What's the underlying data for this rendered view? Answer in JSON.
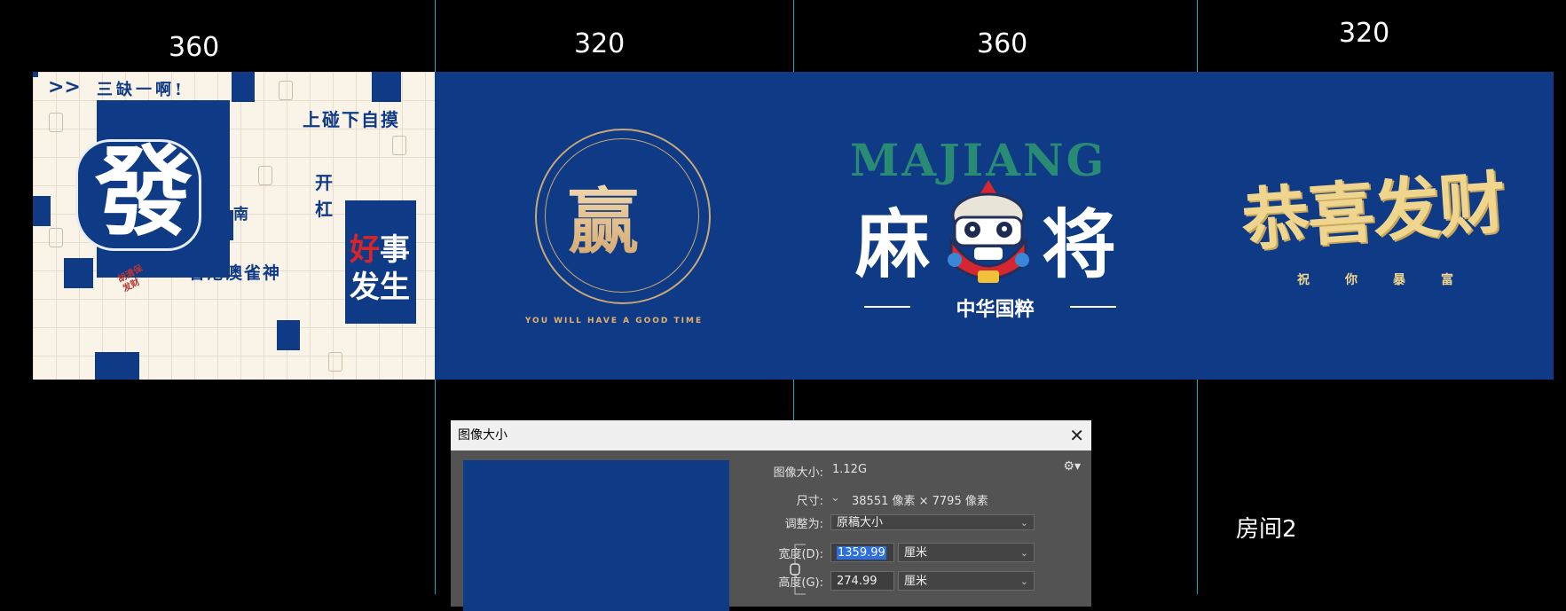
{
  "guides": [
    490,
    894,
    1349
  ],
  "widths": [
    "360",
    "320",
    "360",
    "320"
  ],
  "panel1": {
    "tile_char": "發",
    "top_text": "三缺一啊!",
    "line1": "上碰下自摸",
    "line2": "开杠",
    "line3": "南",
    "line4": "省港澳雀神",
    "line5": "胡清保\n发财",
    "good1": "好",
    "good2": "事",
    "good3": "发生"
  },
  "panel2": {
    "char": "赢",
    "subtitle": "YOU WILL HAVE A GOOD TIME"
  },
  "panel3": {
    "title": "MAJIANG",
    "left": "麻",
    "right": "将",
    "subtitle": "中华国粹"
  },
  "panel4": {
    "title": "恭喜发财",
    "subtitle": "祝你暴富"
  },
  "dialog": {
    "title": "图像大小",
    "close": "✕",
    "gear": "⚙▾",
    "size_label": "图像大小:",
    "size_value": "1.12G",
    "dims_label": "尺寸:",
    "dims_value": "38551 像素 × 7795 像素",
    "fit_label": "调整为:",
    "fit_value": "原稿大小",
    "width_label": "宽度(D):",
    "width_value": "1359.99",
    "width_unit": "厘米",
    "height_label": "高度(G):",
    "height_value": "274.99",
    "height_unit": "厘米"
  },
  "room_label": "房间2",
  "colors": {
    "navy": "#0f3a86",
    "cream": "#faf3e8",
    "gold": "#efd58e",
    "guide": "#1fb7d4"
  }
}
